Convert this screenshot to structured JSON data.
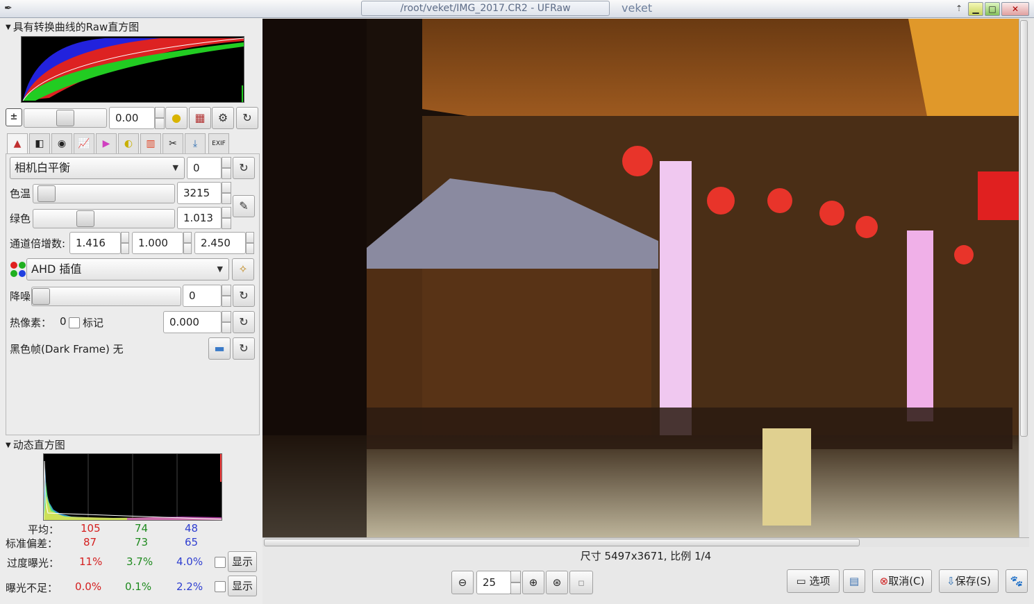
{
  "window": {
    "title": "/root/veket/IMG_2017.CR2 - UFRaw",
    "host": "veket",
    "up_btn": "⇡",
    "min_btn": "▁",
    "max_btn": "□",
    "close_btn": "✕"
  },
  "raw_histogram": {
    "title": "具有转换曲线的Raw直方图"
  },
  "exposure": {
    "value": "0.00"
  },
  "white_balance": {
    "preset": "相机白平衡",
    "fine_tune": "0",
    "temperature_label": "色温",
    "temperature": "3215",
    "green_label": "绿色",
    "green": "1.013",
    "channel_label": "通道倍增数:",
    "ch1": "1.416",
    "ch2": "1.000",
    "ch3": "2.450"
  },
  "interpolation": {
    "value": "AHD 插值"
  },
  "denoise": {
    "label": "降噪",
    "value": "0"
  },
  "hot_pixels": {
    "label": "热像素：",
    "count": "0",
    "mark_label": "标记",
    "value": "0.000"
  },
  "dark_frame": {
    "label": "黑色帧(Dark Frame) 无"
  },
  "live_histogram": {
    "title": "动态直方图",
    "avg_label": "平均：",
    "avg": [
      "105",
      "74",
      "48"
    ],
    "std_label": "标准偏差：",
    "std": [
      "87",
      "73",
      "65"
    ],
    "over_label": "过度曝光：",
    "over": [
      "11%",
      "3.7%",
      "4.0%"
    ],
    "under_label": "曝光不足：",
    "under": [
      "0.0%",
      "0.1%",
      "2.2%"
    ],
    "show_label": "显示"
  },
  "status": {
    "size_text": "尺寸 5497x3671, 比例 1/4"
  },
  "bottom": {
    "zoom": "25",
    "options": "选项",
    "cancel": "取消(C)",
    "save": "保存(S)"
  },
  "colors": {
    "red": "#d42020",
    "green": "#1f8a1f",
    "blue": "#2f3fd0"
  }
}
